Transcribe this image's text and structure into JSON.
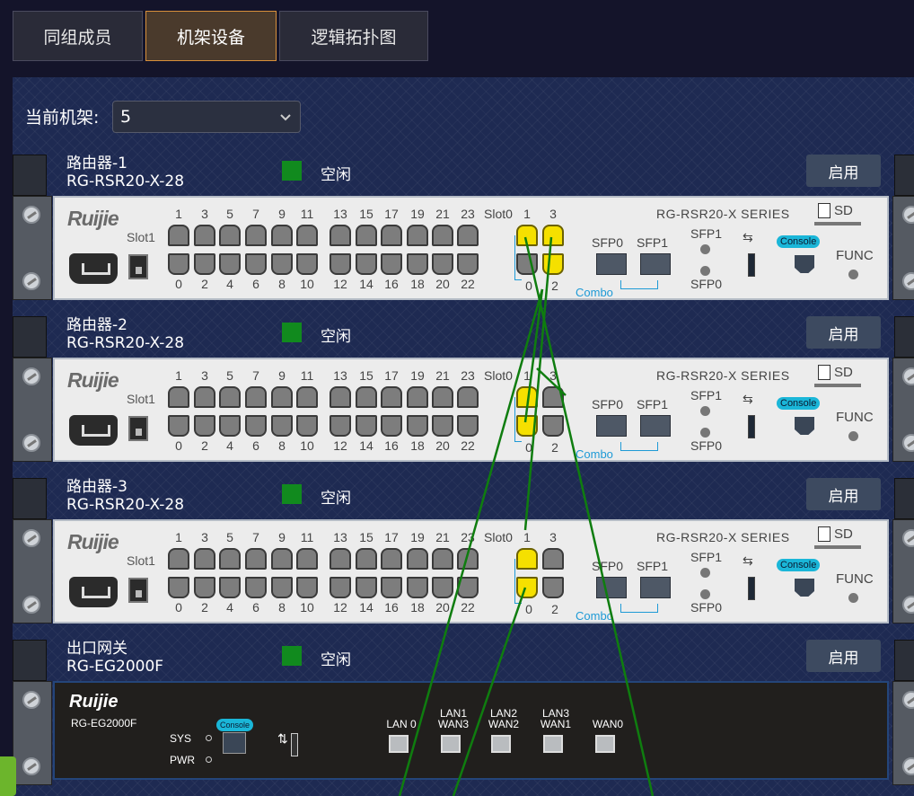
{
  "tabs": [
    {
      "label": "同组成员",
      "active": false
    },
    {
      "label": "机架设备",
      "active": true
    },
    {
      "label": "逻辑拓扑图",
      "active": false
    }
  ],
  "rack": {
    "label": "当前机架:",
    "value": "5"
  },
  "devices": [
    {
      "name": "路由器-1",
      "model": "RG-RSR20-X-28",
      "status": "空闲",
      "button": "启用"
    },
    {
      "name": "路由器-2",
      "model": "RG-RSR20-X-28",
      "status": "空闲",
      "button": "启用"
    },
    {
      "name": "路由器-3",
      "model": "RG-RSR20-X-28",
      "status": "空闲",
      "button": "启用"
    },
    {
      "name": "出口网关",
      "model": "RG-EG2000F",
      "status": "空闲",
      "button": "启用"
    }
  ],
  "router_panel": {
    "logo": "Ruijie",
    "slot1": "Slot1",
    "slot0": "Slot0",
    "series": "RG-RSR20-X SERIES",
    "sd": "SD",
    "sfp0": "SFP0",
    "sfp1": "SFP1",
    "sfp1_led": "SFP1",
    "sfp0_led": "SFP0",
    "console": "Console",
    "func": "FUNC",
    "combo": "Combo",
    "top_ports": [
      "1",
      "3",
      "5",
      "7",
      "9",
      "11",
      "13",
      "15",
      "17",
      "19",
      "21",
      "23"
    ],
    "bottom_ports": [
      "0",
      "2",
      "4",
      "6",
      "8",
      "10",
      "12",
      "14",
      "16",
      "18",
      "20",
      "22"
    ],
    "slot0_top": [
      "1",
      "3"
    ],
    "slot0_bottom": [
      "0",
      "2"
    ]
  },
  "gateway_panel": {
    "logo": "Ruijie",
    "model": "RG-EG2000F",
    "sys": "SYS",
    "pwr": "PWR",
    "console": "Console",
    "ports": [
      {
        "l1": "",
        "l2": "LAN 0"
      },
      {
        "l1": "LAN1",
        "l2": "WAN3"
      },
      {
        "l1": "LAN2",
        "l2": "WAN2"
      },
      {
        "l1": "LAN3",
        "l2": "WAN1"
      },
      {
        "l1": "",
        "l2": "WAN0"
      }
    ]
  },
  "colors": {
    "status": "#118a1e",
    "highlight_port": "#f5e000",
    "cable": "#0f7d0f",
    "active_tab": "#d8903a"
  }
}
